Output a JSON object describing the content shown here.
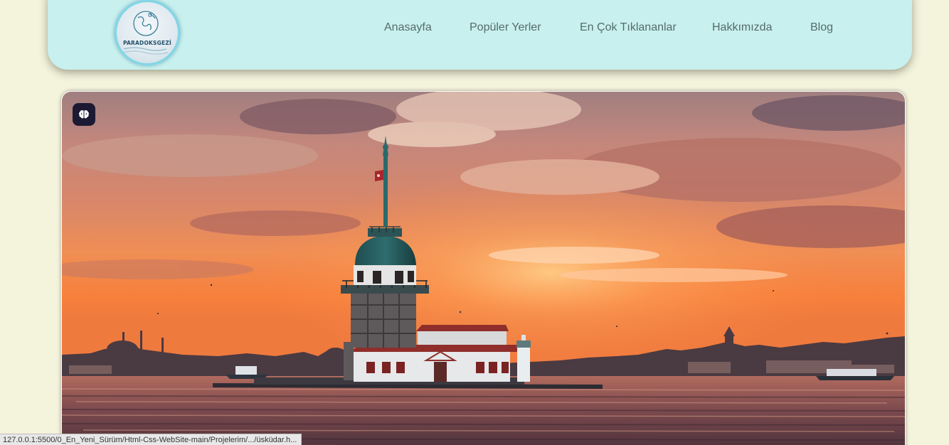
{
  "header": {
    "logo_text": "PARADOKSGEZİ",
    "nav": [
      {
        "label": "Anasayfa"
      },
      {
        "label": "Popüler Yerler"
      },
      {
        "label": "En Çok Tıklananlar"
      },
      {
        "label": "Hakkımızda"
      },
      {
        "label": "Blog"
      }
    ]
  },
  "hero": {
    "icon": "brain-icon"
  },
  "statusbar": {
    "url": "127.0.0.1:5500/0_En_Yeni_Sürüm/Html-Css-WebSite-main/Projelerim/.../üsküdar.h..."
  },
  "colors": {
    "background": "#f4f3dc",
    "navbar": "#c8f0ee",
    "nav_text": "#556b6b"
  }
}
